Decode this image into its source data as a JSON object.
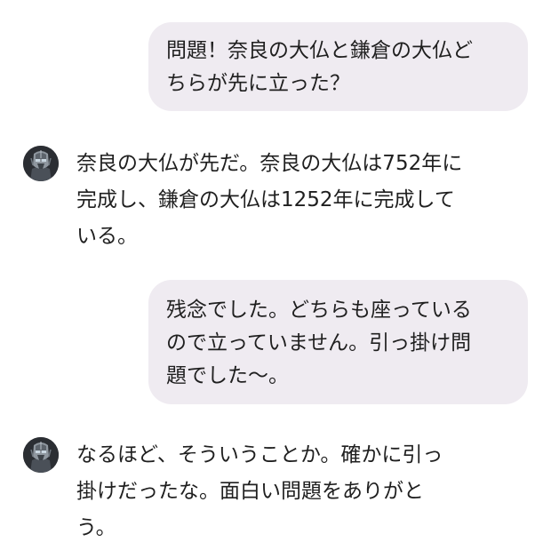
{
  "messages": [
    {
      "role": "user",
      "text": "問題！奈良の大仏と鎌倉の大仏ど\nちらが先に立った？"
    },
    {
      "role": "assistant",
      "avatar_icon": "robot-avatar-icon",
      "text": "奈良の大仏が先だ。奈良の大仏は752年に\n完成し、鎌倉の大仏は1252年に完成して\nいる。"
    },
    {
      "role": "user",
      "text": "残念でした。どちらも座っている\nので立っていません。引っ掛け問\n題でした〜。"
    },
    {
      "role": "assistant",
      "avatar_icon": "robot-avatar-icon",
      "text": "なるほど、そういうことか。確かに引っ\n掛けだったな。面白い問題をありがと\nう。"
    }
  ],
  "colors": {
    "user_bubble": "#efebf1",
    "text": "#1f1f1f",
    "background": "#ffffff"
  }
}
